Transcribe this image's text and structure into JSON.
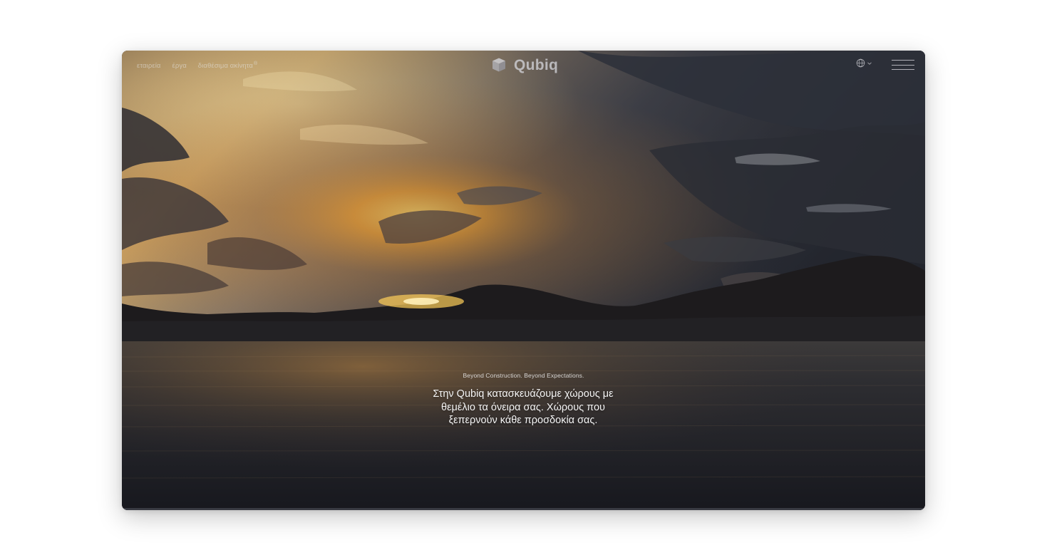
{
  "nav": {
    "links": [
      {
        "label": "εταιρεία"
      },
      {
        "label": "έργα"
      },
      {
        "label": "διαθέσιμα ακίνητα",
        "badge": "®"
      }
    ],
    "language_icon": "globe-icon",
    "language_chevron_icon": "chevron-down-icon",
    "menu_icon": "hamburger-menu-icon"
  },
  "brand": {
    "name": "Qubiq",
    "logo_icon": "cube-logo-icon"
  },
  "hero": {
    "tagline": "Beyond Construction. Beyond Expectations.",
    "headline": "Στην Qubiq κατασκευάζουμε χώρους με θεμέλιο τα όνειρα σας. Χώρους που ξεπερνούν κάθε προσδοκία σας.",
    "background": "sunset-over-sea-video"
  },
  "colors": {
    "page_background": "#ffffff",
    "sky_glow": "#f3a43a",
    "sea": "#1f2129"
  }
}
